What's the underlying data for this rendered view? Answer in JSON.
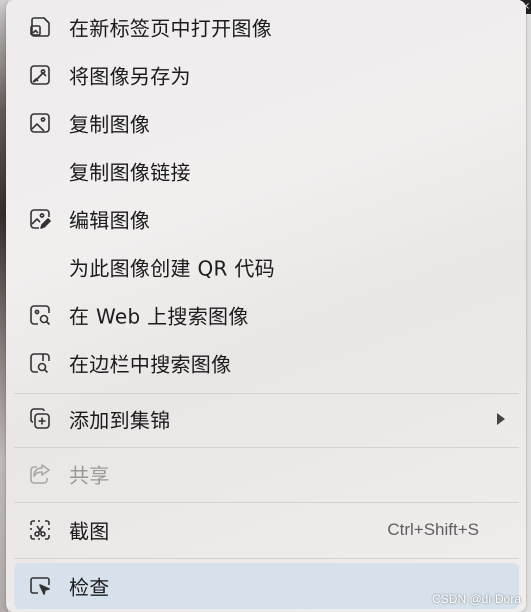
{
  "menu": {
    "items": [
      {
        "label": "在新标签页中打开图像",
        "icon": "open-image-new-tab-icon"
      },
      {
        "label": "将图像另存为",
        "icon": "save-image-as-icon"
      },
      {
        "label": "复制图像",
        "icon": "copy-image-icon"
      },
      {
        "label": "复制图像链接",
        "icon": ""
      },
      {
        "label": "编辑图像",
        "icon": "edit-image-icon"
      },
      {
        "label": "为此图像创建 QR 代码",
        "icon": ""
      },
      {
        "label": "在 Web 上搜索图像",
        "icon": "visual-search-icon"
      },
      {
        "label": "在边栏中搜索图像",
        "icon": "sidebar-search-icon"
      },
      {
        "label": "添加到集锦",
        "icon": "add-to-collections-icon",
        "submenu": true
      },
      {
        "label": "共享",
        "icon": "share-icon",
        "disabled": true
      },
      {
        "label": "截图",
        "icon": "screenshot-icon",
        "shortcut": "Ctrl+Shift+S"
      },
      {
        "label": "检查",
        "icon": "inspect-icon",
        "highlighted": true
      }
    ]
  },
  "watermark": "CSDN @di-Dora",
  "colors": {
    "menu_background": "#efeced",
    "hover_background": "#d6e1eb",
    "text": "#1b1b1b",
    "disabled_text": "#9a9898"
  }
}
